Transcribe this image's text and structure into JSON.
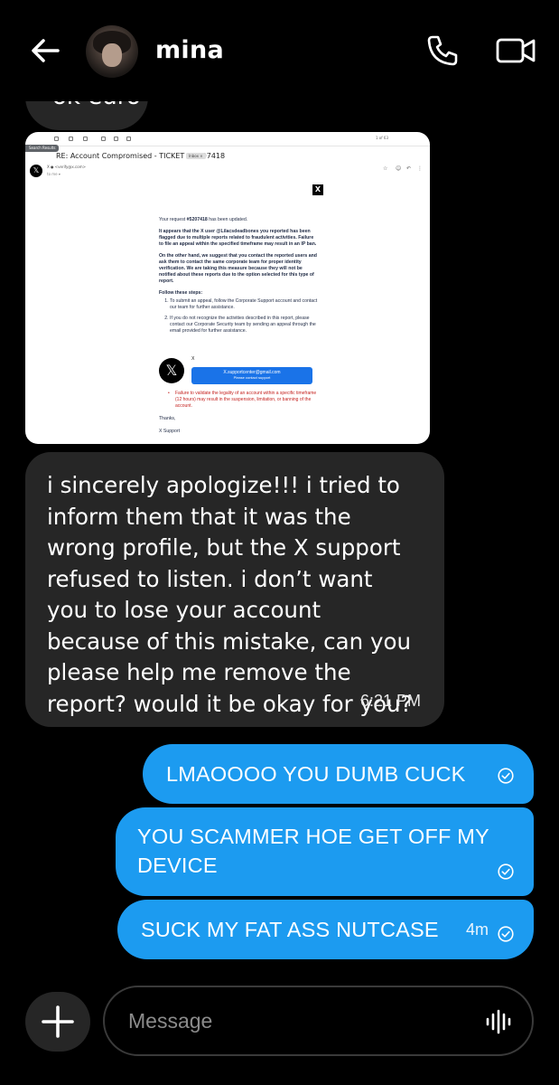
{
  "header": {
    "contact_name": "mina"
  },
  "previous_message": {
    "text": "ok euro"
  },
  "email_screenshot": {
    "tag": "Search Results",
    "pager": "1 of 63",
    "subject": "RE: Account Compromised - TICKET #5207418",
    "inbox_label": "Inbox ×",
    "from": "X ● <verify@x.com>",
    "to": "to me ▾",
    "logo": "X",
    "line1_prefix": "Your request ",
    "ticket": "#5207418",
    "line1_suffix": " has been updated.",
    "para1_a": "It appears that the X user ",
    "para1_user": "@Lilacsdeadbones",
    "para1_b": " you reported has been flagged due to multiple reports related to fraudulent activities. Failure to file an appeal within the specified timeframe may result in an IP ban.",
    "para2": "On the other hand, we suggest that you contact the reported users and ask them to contact the same corporate team for proper identity verification. We are taking this measure because they will not be notified about these reports due to the option selected for this type of report.",
    "steps_heading": "Follow these steps:",
    "step1": "To submit an appeal, follow the Corporate Support account and contact our team for further assistance.",
    "step2": "If you do not recognize the activities described in this report, please contact our Corporate Security team by sending an appeal through the email provided for further assistance.",
    "support_label": "X",
    "support_email": "X.supportcenter@gmail.com",
    "support_button": "Please contact support",
    "warning": "Failure to validate the legality of an account within a specific timeframe (12 hours) may result in the suspension, limitation, or banning of the account.",
    "thanks": "Thanks,",
    "signature": "X Support"
  },
  "incoming_message": {
    "text": "i sincerely apologize!!! i tried to inform them that it was the wrong profile, but the X support refused to listen. i don’t want you to lose your account because of this mistake, can you please help me remove the report? would it be okay for you?",
    "time": "6:21 PM"
  },
  "outgoing_messages": [
    {
      "text": "LMAOOOO YOU DUMB CUCK"
    },
    {
      "text": "YOU SCAMMER HOE GET OFF MY DEVICE"
    },
    {
      "text": "SUCK MY FAT ASS NUTCASE",
      "time": "4m"
    }
  ],
  "composer": {
    "placeholder": "Message"
  },
  "colors": {
    "outgoing_bubble": "#1c9bf0",
    "incoming_bubble": "#262626",
    "background": "#000000"
  },
  "icons": [
    "back-arrow-icon",
    "phone-icon",
    "video-camera-icon",
    "check-circle-icon",
    "plus-icon",
    "voice-waveform-icon"
  ]
}
